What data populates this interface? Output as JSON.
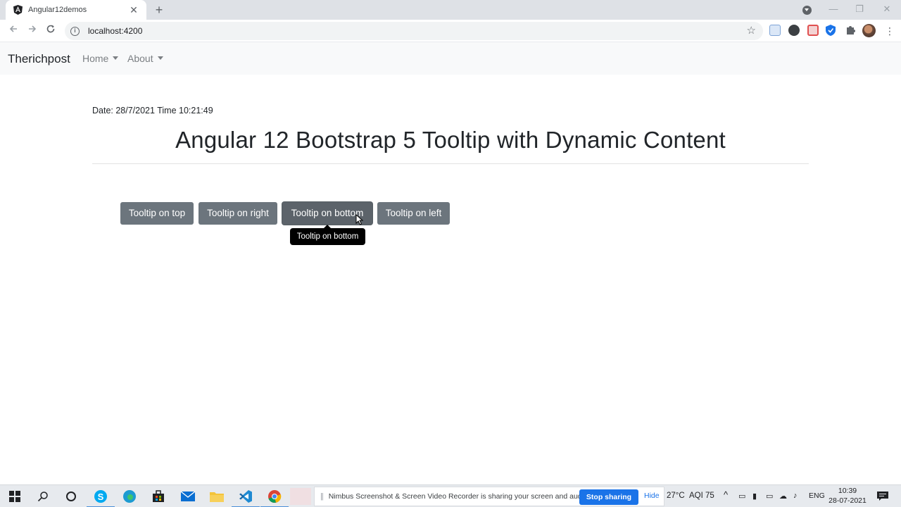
{
  "browser": {
    "tab_title": "Angular12demos",
    "tab_close": "✕",
    "new_tab": "+",
    "url": "localhost:4200",
    "window_controls": [
      "—",
      "❐",
      "✕"
    ]
  },
  "navbar": {
    "brand": "Therichpost",
    "items": [
      {
        "label": "Home",
        "icon": "caret-down-icon"
      },
      {
        "label": "About",
        "icon": "caret-down-icon"
      }
    ]
  },
  "main": {
    "datetime": "Date: 28/7/2021 Time 10:21:49",
    "heading": "Angular 12 Bootstrap 5 Tooltip with Dynamic Content",
    "buttons": [
      {
        "label": "Tooltip on top"
      },
      {
        "label": "Tooltip on right"
      },
      {
        "label": "Tooltip on bottom"
      },
      {
        "label": "Tooltip on left"
      }
    ],
    "tooltip_text": "Tooltip on bottom"
  },
  "taskbar": {
    "share_message": "Nimbus Screenshot & Screen Video Recorder is sharing your screen and audio.",
    "stop_sharing": "Stop sharing",
    "hide": "Hide",
    "temperature": "27°C",
    "aqi": "AQI 75",
    "language": "ENG",
    "time": "10:39",
    "date": "28-07-2021"
  },
  "colors": {
    "button": "#6c757d",
    "navbar_bg": "#f8f9fa",
    "tooltip_bg": "#000000",
    "share_button": "#1a73e8"
  }
}
